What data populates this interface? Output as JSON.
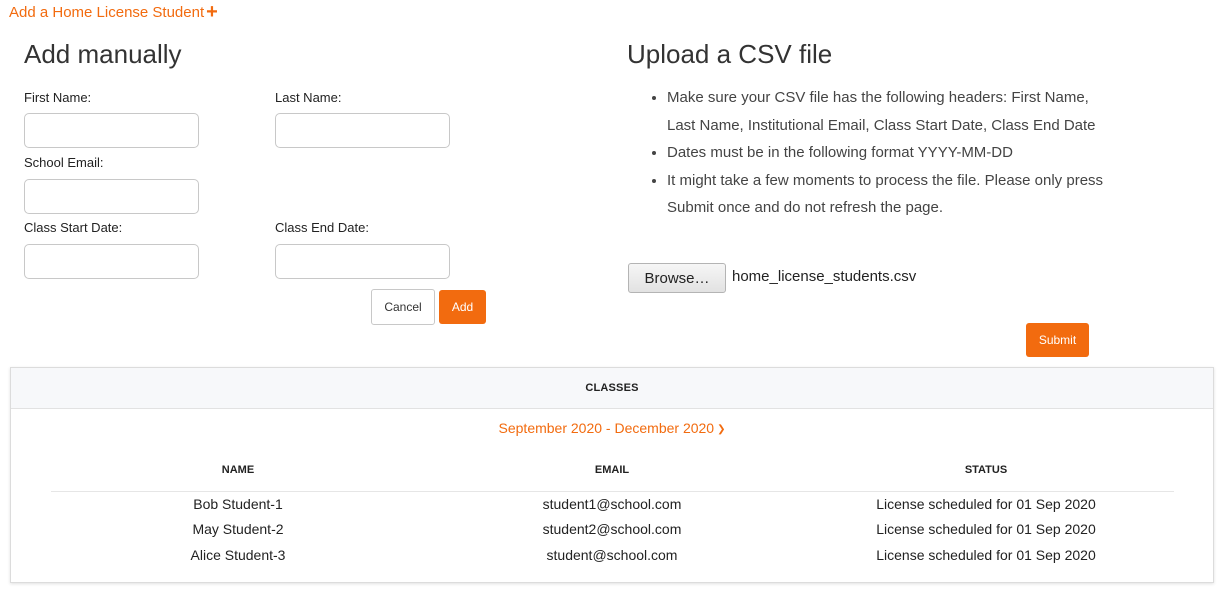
{
  "top_link": {
    "label": "Add a Home License Student",
    "icon": "plus-icon"
  },
  "manual": {
    "title": "Add manually",
    "fields": {
      "first_name": {
        "label": "First Name:",
        "value": ""
      },
      "last_name": {
        "label": "Last Name:",
        "value": ""
      },
      "school_email": {
        "label": "School Email:",
        "value": ""
      },
      "class_start": {
        "label": "Class Start Date:",
        "value": ""
      },
      "class_end": {
        "label": "Class End Date:",
        "value": ""
      }
    },
    "cancel_label": "Cancel",
    "add_label": "Add"
  },
  "upload": {
    "title": "Upload a CSV file",
    "instructions": [
      "Make sure your CSV file has the following headers: First Name, Last Name, Institutional Email, Class Start Date, Class End Date",
      "Dates must be in the following format YYYY-MM-DD",
      "It might take a few moments to process the file. Please only press Submit once and do not refresh the page."
    ],
    "browse_label": "Browse…",
    "file_name": "home_license_students.csv",
    "submit_label": "Submit"
  },
  "classes": {
    "header": "CLASSES",
    "term": "September 2020 - December 2020",
    "term_icon": "chevron-down-icon",
    "columns": [
      "NAME",
      "EMAIL",
      "STATUS"
    ],
    "rows": [
      {
        "name": "Bob Student-1",
        "email": "student1@school.com",
        "status": "License scheduled for 01 Sep 2020"
      },
      {
        "name": "May Student-2",
        "email": "student2@school.com",
        "status": "License scheduled for 01 Sep 2020"
      },
      {
        "name": "Alice Student-3",
        "email": "student@school.com",
        "status": "License scheduled for 01 Sep 2020"
      }
    ]
  },
  "colors": {
    "accent": "#f26b0f",
    "panel_header_bg": "#f7f8fa",
    "border": "#c8c8c8"
  }
}
